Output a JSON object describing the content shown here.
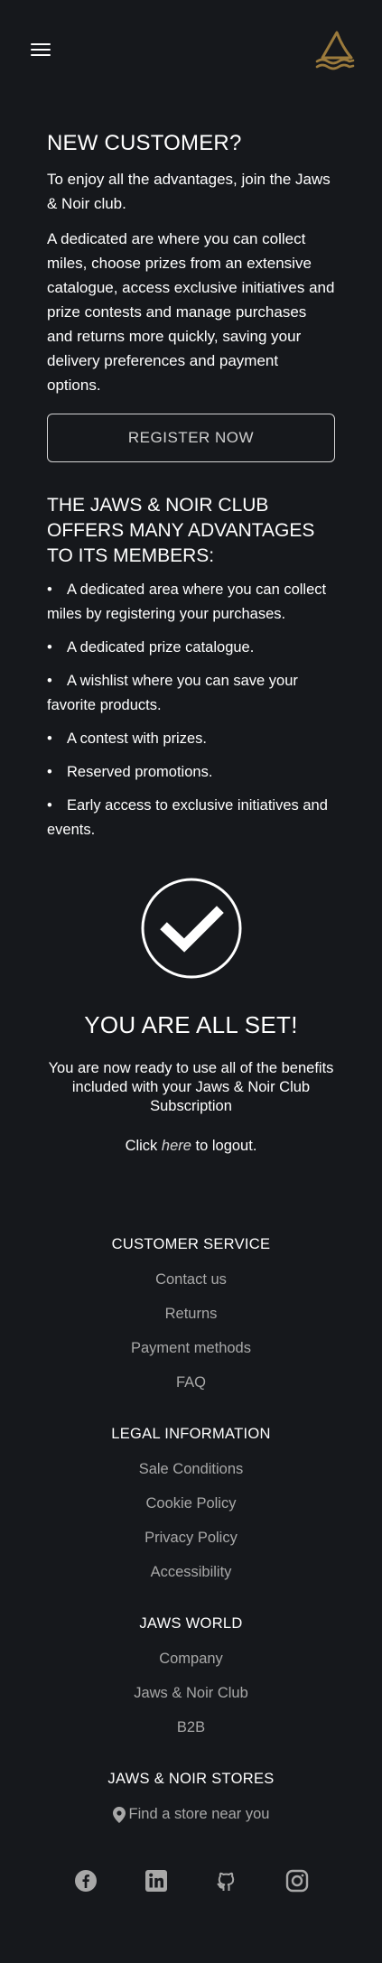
{
  "header": {
    "menu_icon": "hamburger-menu-icon",
    "logo_icon": "shark-fin-waves-logo",
    "logo_color": "#9b7a3c"
  },
  "new_customer": {
    "title": "NEW CUSTOMER?",
    "intro": "To enjoy all the advantages, join the Jaws & Noir club.",
    "description": "A dedicated are where you can collect miles, choose prizes from an extensive catalogue, access exclusive initiatives and prize contests and manage purchases and returns more quickly, saving your delivery preferences and payment options.",
    "register_button": "REGISTER NOW"
  },
  "advantages": {
    "title": "THE JAWS & NOIR CLUB OFFERS MANY ADVANTAGES TO ITS MEMBERS:",
    "items": [
      "A dedicated area where you can collect miles by registering your purchases.",
      "A dedicated prize catalogue.",
      "A wishlist where you can save your favorite products.",
      "A contest with prizes.",
      "Reserved promotions.",
      "Early access to exclusive initiatives and events."
    ]
  },
  "confirmation": {
    "icon": "check-circle-icon",
    "title": "YOU ARE ALL SET!",
    "message": "You are now ready to use all of the benefits included with your Jaws & Noir Club Subscription",
    "logout_prefix": "Click ",
    "logout_link": "here",
    "logout_suffix": " to logout."
  },
  "footer": {
    "customer_service": {
      "title": "CUSTOMER SERVICE",
      "links": [
        "Contact us",
        "Returns",
        "Payment methods",
        "FAQ"
      ]
    },
    "legal": {
      "title": "LEGAL INFORMATION",
      "links": [
        "Sale Conditions",
        "Cookie Policy",
        "Privacy Policy",
        "Accessibility"
      ]
    },
    "world": {
      "title": "JAWS WORLD",
      "links": [
        "Company",
        "Jaws & Noir Club",
        "B2B"
      ]
    },
    "stores": {
      "title": "JAWS & NOIR STORES",
      "link": "Find a store near you",
      "icon": "map-pin-icon"
    },
    "socials": [
      "facebook-icon",
      "linkedin-icon",
      "github-icon",
      "instagram-icon"
    ]
  }
}
